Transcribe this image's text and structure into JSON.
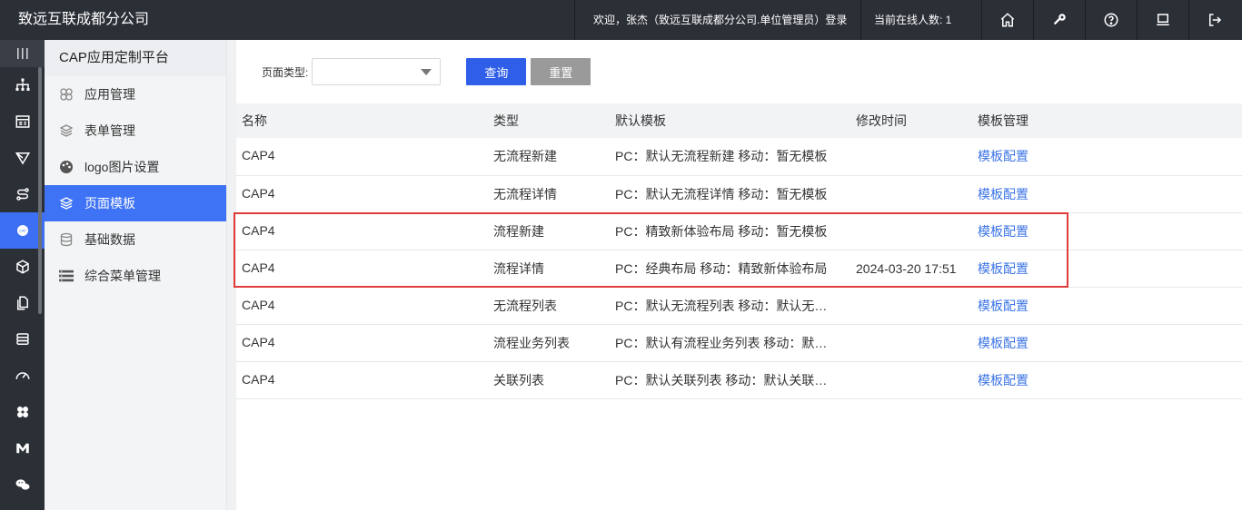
{
  "header": {
    "brand": "致远互联成都分公司",
    "welcome": "欢迎，张杰（致远互联成都分公司.单位管理员）登录",
    "online": "当前在线人数: 1",
    "buttons": [
      "home-icon",
      "key-icon",
      "help-icon",
      "monitor-icon",
      "logout-icon"
    ]
  },
  "rail": {
    "icons": [
      "org-tree-icon",
      "form-table-icon",
      "send-icon",
      "route-icon",
      "cap-icon",
      "cube-icon",
      "copy-icon",
      "database-icon",
      "gauge-icon",
      "flower-icon",
      "m-logo-icon",
      "wechat-icon"
    ],
    "active_index": 4,
    "active_badge": "CAP"
  },
  "subnav": {
    "title": "CAP应用定制平台",
    "items": [
      {
        "label": "应用管理",
        "icon": "app-grid-icon"
      },
      {
        "label": "表单管理",
        "icon": "layers-icon"
      },
      {
        "label": "logo图片设置",
        "icon": "palette-icon"
      },
      {
        "label": "页面模板",
        "icon": "layers-icon",
        "active": true
      },
      {
        "label": "基础数据",
        "icon": "database-icon"
      },
      {
        "label": "综合菜单管理",
        "icon": "menu-list-icon"
      }
    ]
  },
  "filter": {
    "label": "页面类型:",
    "select_value": "",
    "query_label": "查询",
    "reset_label": "重置"
  },
  "table": {
    "headers": [
      "名称",
      "类型",
      "默认模板",
      "修改时间",
      "模板管理"
    ],
    "rows": [
      {
        "name": "CAP4",
        "type": "无流程新建",
        "template": "PC：默认无流程新建   移动：暂无模板",
        "time": "",
        "action": "模板配置"
      },
      {
        "name": "CAP4",
        "type": "无流程详情",
        "template": "PC：默认无流程详情   移动：暂无模板",
        "time": "",
        "action": "模板配置"
      },
      {
        "name": "CAP4",
        "type": "流程新建",
        "template": "PC：精致新体验布局   移动：暂无模板",
        "time": "",
        "action": "模板配置"
      },
      {
        "name": "CAP4",
        "type": "流程详情",
        "template": "PC：经典布局   移动：精致新体验布局",
        "time": "2024-03-20 17:51",
        "action": "模板配置"
      },
      {
        "name": "CAP4",
        "type": "无流程列表",
        "template": "PC：默认无流程列表   移动：默认无…",
        "time": "",
        "action": "模板配置"
      },
      {
        "name": "CAP4",
        "type": "流程业务列表",
        "template": "PC：默认有流程业务列表   移动：默…",
        "time": "",
        "action": "模板配置"
      },
      {
        "name": "CAP4",
        "type": "关联列表",
        "template": "PC：默认关联列表   移动：默认关联…",
        "time": "",
        "action": "模板配置"
      }
    ]
  },
  "colors": {
    "topbar": "#2b2f36",
    "accent": "#3f73f5",
    "highlight_border": "#e23b3b",
    "link": "#3b74e6"
  }
}
